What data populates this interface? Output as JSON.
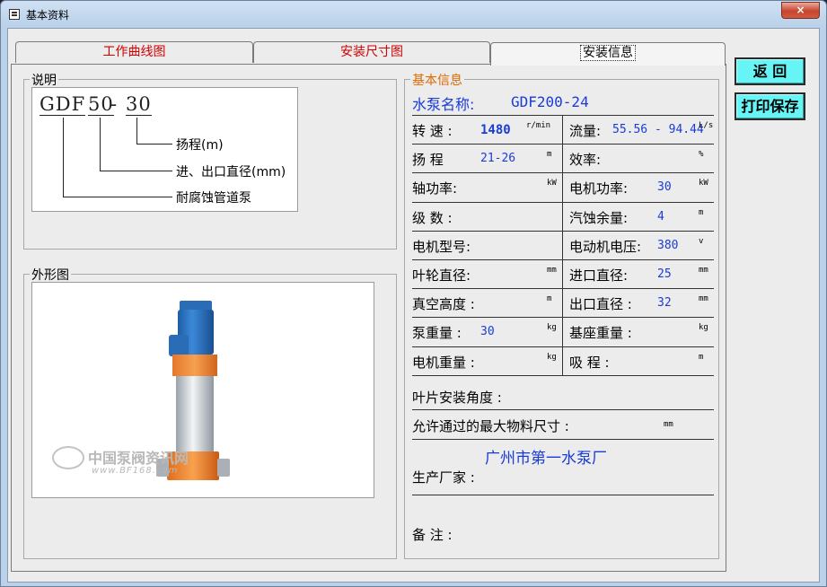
{
  "window": {
    "title": "基本资料",
    "close_label": "×"
  },
  "tabs": [
    {
      "label": "工作曲线图"
    },
    {
      "label": "安装尺寸图"
    },
    {
      "label": "安装信息"
    }
  ],
  "legend_group": {
    "title": "说明",
    "model": {
      "part1": "GDF",
      "part2": "50",
      "dash": "-",
      "part3": "30"
    },
    "lines": [
      "扬程(m)",
      "进、出口直径(mm)",
      "耐腐蚀管道泵"
    ]
  },
  "shape_group": {
    "title": "外形图",
    "watermark": "中国泵阀资讯网",
    "watermark_url": "www.BF168.com"
  },
  "info": {
    "title": "基本信息",
    "pump_name_label": "水泵名称:",
    "pump_name_value": "GDF200-24",
    "rows": [
      {
        "l_label": "转 速 :",
        "l_val": "1480",
        "l_unit": "r/min",
        "r_label": "流量:",
        "r_val": "55.56 - 94.44",
        "r_unit": "L/s"
      },
      {
        "l_label": "扬 程",
        "l_val": "21-26",
        "l_unit": "m",
        "r_label": "效率:",
        "r_val": "",
        "r_unit": "%"
      },
      {
        "l_label": "轴功率:",
        "l_val": "",
        "l_unit": "kW",
        "r_label": "电机功率:",
        "r_val": "30",
        "r_unit": "kW"
      },
      {
        "l_label": "级 数 :",
        "l_val": "",
        "l_unit": "",
        "r_label": "汽蚀余量:",
        "r_val": "4",
        "r_unit": "m"
      },
      {
        "l_label": "电机型号:",
        "l_val": "",
        "l_unit": "",
        "r_label": "电动机电压:",
        "r_val": "380",
        "r_unit": "v"
      },
      {
        "l_label": "叶轮直径:",
        "l_val": "",
        "l_unit": "mm",
        "r_label": "进口直径:",
        "r_val": "25",
        "r_unit": "mm"
      },
      {
        "l_label": "真空高度 :",
        "l_val": "",
        "l_unit": "m",
        "r_label": "出口直径 :",
        "r_val": "32",
        "r_unit": "mm"
      },
      {
        "l_label": "泵重量 :",
        "l_val": "30",
        "l_unit": "kg",
        "r_label": "基座重量 :",
        "r_val": "",
        "r_unit": "kg"
      },
      {
        "l_label": "电机重量 :",
        "l_val": "",
        "l_unit": "kg",
        "r_label": "吸 程 :",
        "r_val": "",
        "r_unit": "m"
      }
    ],
    "blade_angle_label": "叶片安装角度 :",
    "max_material_label": "允许通过的最大物料尺寸 :",
    "max_material_unit": "mm",
    "manufacturer_label": "生产厂家 :",
    "manufacturer_value": "广州市第一水泵厂",
    "remark_label": "备 注 :"
  },
  "buttons": {
    "back": "返 回",
    "print_save": "打印保存"
  }
}
